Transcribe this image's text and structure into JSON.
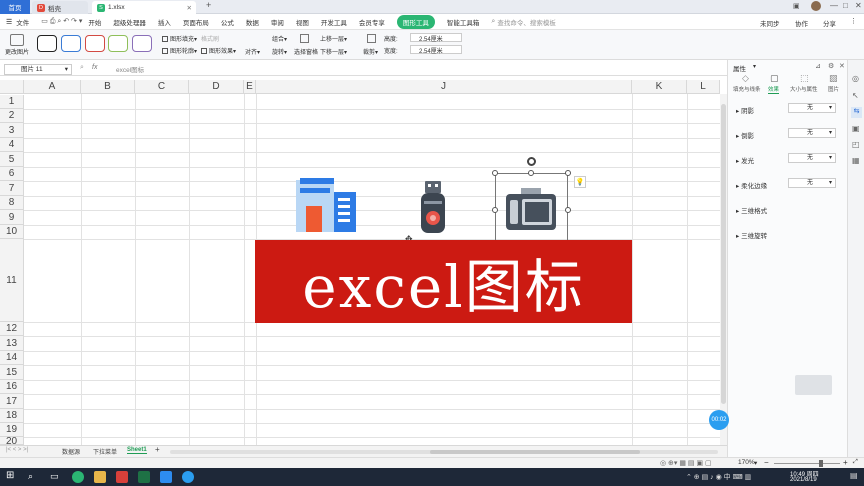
{
  "titlebar": {
    "home_tab": "首页",
    "tab1": "稻壳",
    "tab2": "1.xlsx",
    "add_tab": "+"
  },
  "menubar": {
    "file_menu": "文件",
    "items": [
      "开始",
      "超级处理器",
      "插入",
      "页面布局",
      "公式",
      "数据",
      "审阅",
      "视图",
      "开发工具",
      "会员专享"
    ],
    "active": "图形工具",
    "smart": "智能工具箱",
    "search_placeholder": "查找命令、搜索模板",
    "right": [
      "未同步",
      "协作",
      "分享"
    ]
  },
  "ribbon": {
    "change_picture": "更改图片",
    "fill": "图形填充",
    "outline": "图形轮廓",
    "format_brush": "格式刷",
    "effects": "图形效果",
    "align": "对齐",
    "rotate": "旋转",
    "combine": "组合",
    "select_pane": "选择窗格",
    "bring_forward": "上移一层",
    "send_backward": "下移一层",
    "crop": "裁剪",
    "height_label": "高度:",
    "height_value": "2.54厘米",
    "width_label": "宽度:",
    "width_value": "2.54厘米"
  },
  "formulabar": {
    "namebox": "图片 11",
    "fx": "fx",
    "content": "excel图标"
  },
  "sheet": {
    "columns": [
      "A",
      "B",
      "C",
      "D",
      "E",
      "J",
      "K",
      "L"
    ],
    "rows": [
      "1",
      "2",
      "3",
      "4",
      "5",
      "6",
      "7",
      "8",
      "9",
      "10",
      "11",
      "12",
      "13",
      "14",
      "15",
      "16",
      "17",
      "18",
      "19",
      "20"
    ],
    "banner": "excel图标"
  },
  "sheettabs": [
    "数据源",
    "下拉菜单",
    "Sheet1"
  ],
  "rightpanel": {
    "title": "属性",
    "tabs": [
      "填充与线条",
      "效果",
      "大小与属性",
      "图片"
    ],
    "props": [
      {
        "label": "阴影",
        "value": "无"
      },
      {
        "label": "倒影",
        "value": "无"
      },
      {
        "label": "发光",
        "value": "无"
      },
      {
        "label": "柔化边缘",
        "value": "无"
      },
      {
        "label": "三维格式",
        "value": ""
      },
      {
        "label": "三维旋转",
        "value": ""
      }
    ]
  },
  "timer": "00:02",
  "status": {
    "zoom": "170%"
  },
  "clock": {
    "time": "10:49 周四",
    "date": "2021/8/19"
  },
  "colors": {
    "banner_red": "#cc1a12",
    "accent_green": "#2bb673",
    "home_blue": "#2f6fd6"
  }
}
